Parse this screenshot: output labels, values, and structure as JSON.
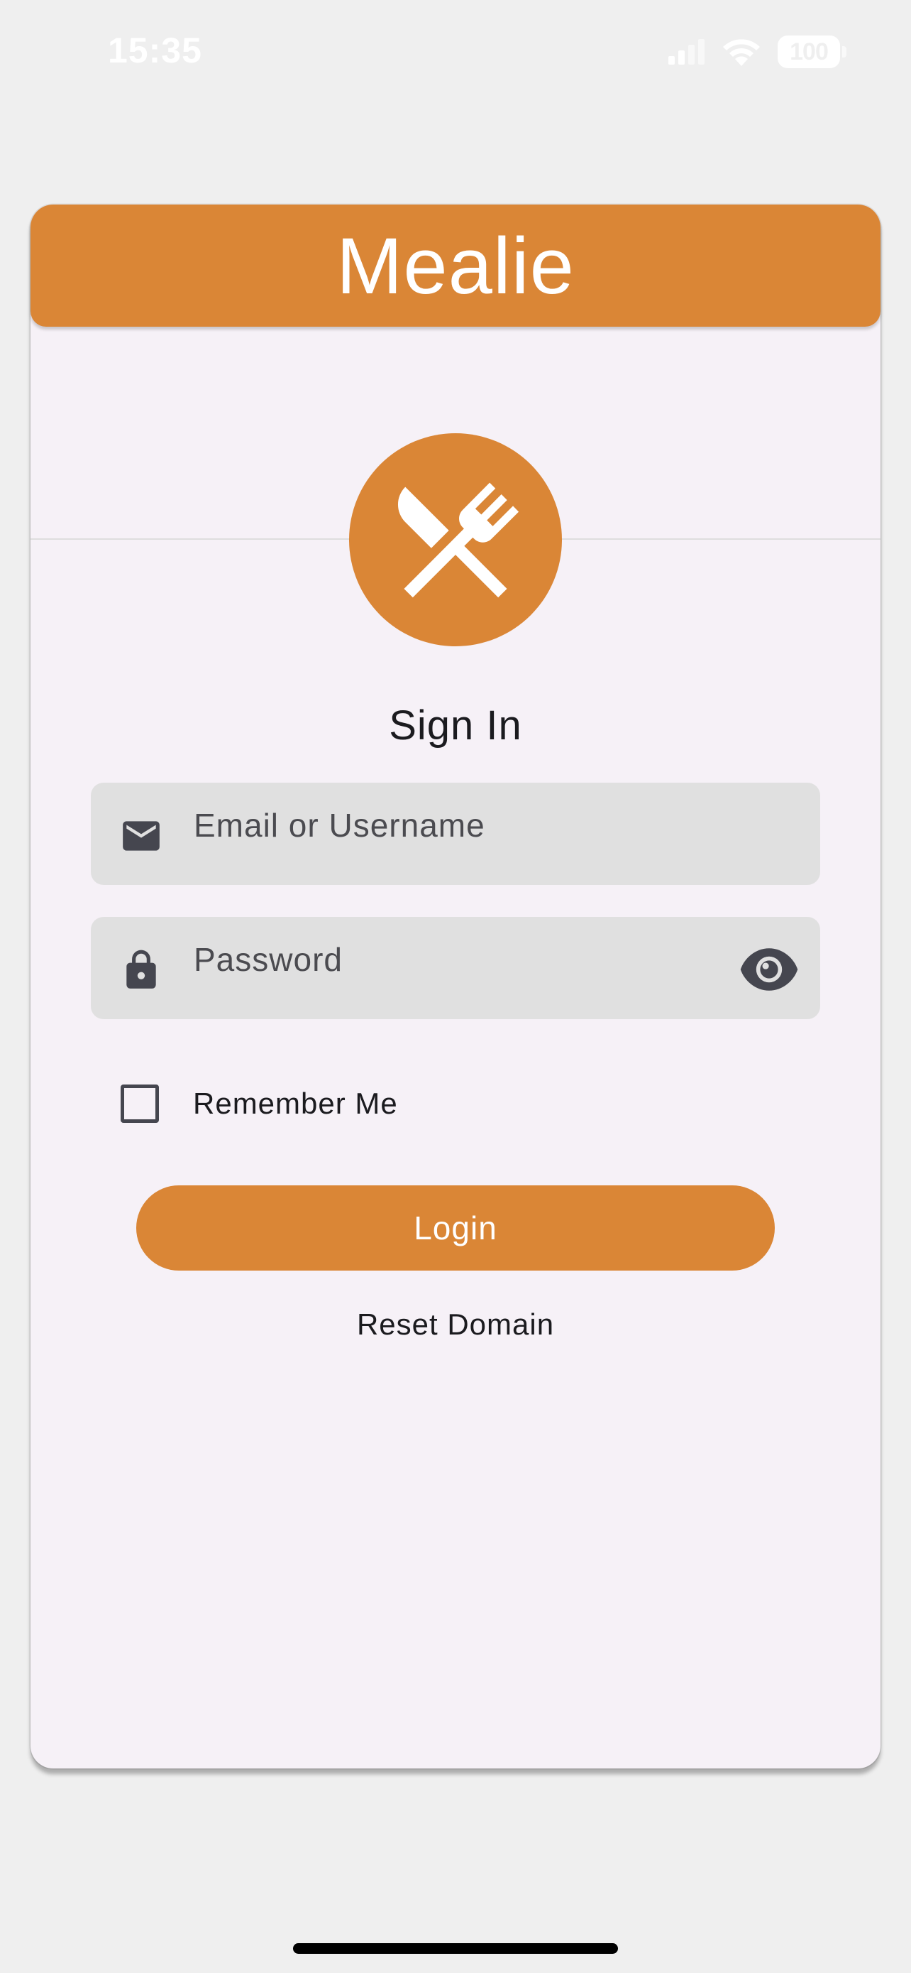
{
  "status_bar": {
    "time": "15:35",
    "battery_level": "100",
    "icons": [
      "cellular-signal-icon",
      "wifi-icon",
      "battery-icon"
    ]
  },
  "header": {
    "app_title": "Mealie"
  },
  "logo": {
    "icon": "fork-knife-icon"
  },
  "form": {
    "title": "Sign In",
    "email": {
      "icon": "mail-icon",
      "placeholder": "Email or Username",
      "value": ""
    },
    "password": {
      "icon": "lock-icon",
      "placeholder": "Password",
      "value": "",
      "toggle_icon": "eye-icon"
    },
    "remember_me": {
      "label": "Remember Me",
      "checked": false
    },
    "login_label": "Login",
    "reset_domain_label": "Reset Domain"
  },
  "colors": {
    "accent": "#da8636",
    "page_background": "#efefef",
    "card_background": "#f6f1f7",
    "field_background": "#e0e0e0",
    "text_primary": "#1b1b1f",
    "icon_dark": "#45464f"
  }
}
